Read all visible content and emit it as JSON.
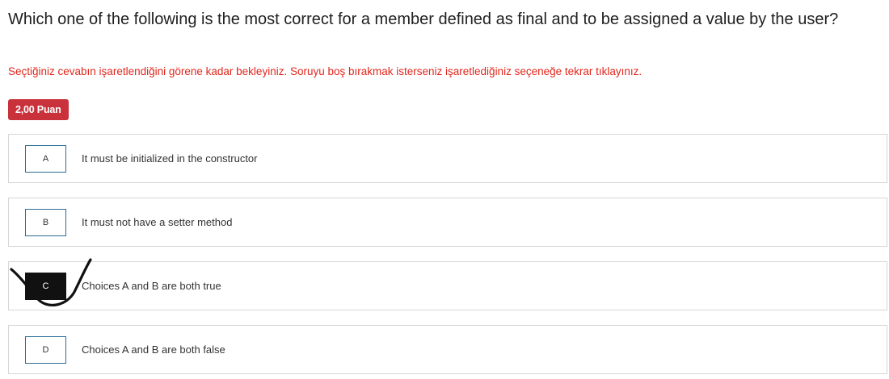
{
  "question": {
    "text": "Which one of the following is the most correct for a member defined as final and to be assigned a value by the user?"
  },
  "instruction": "Seçtiğiniz cevabın işaretlendiğini görene kadar bekleyiniz. Soruyu boş bırakmak isterseniz işaretlediğiniz seçeneğe tekrar tıklayınız.",
  "points_badge": "2,00 Puan",
  "options": [
    {
      "letter": "A",
      "text": "It must be initialized in the constructor",
      "selected": false
    },
    {
      "letter": "B",
      "text": "It must not have a setter method",
      "selected": false
    },
    {
      "letter": "C",
      "text": "Choices A and B are both true",
      "selected": true
    },
    {
      "letter": "D",
      "text": "Choices A and B are both false",
      "selected": false
    }
  ],
  "annotations": {
    "handwritten_mark": "check-mark-icon"
  },
  "colors": {
    "instruction": "#e2261c",
    "badge_bg": "#c9323b",
    "selected_box": "#111111",
    "box_border": "#2c6b95"
  }
}
